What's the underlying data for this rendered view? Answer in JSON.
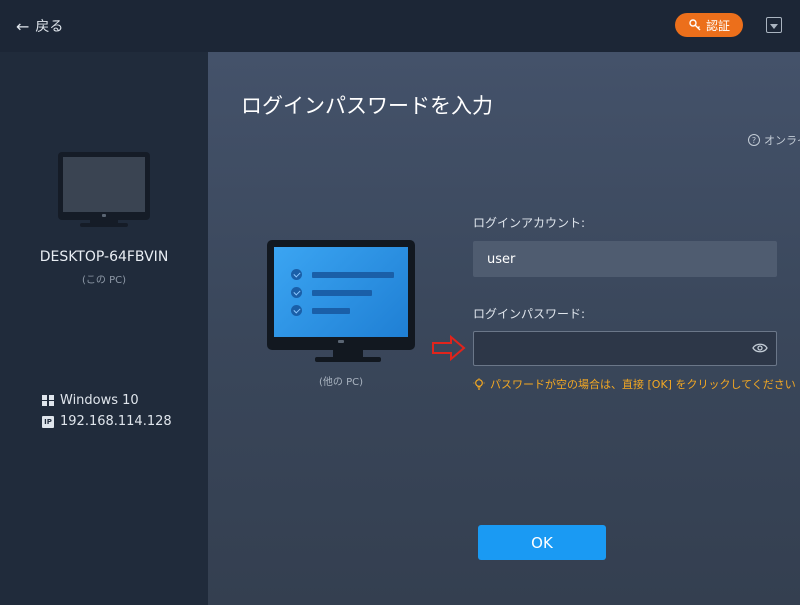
{
  "topbar": {
    "back_label": "戻る",
    "auth_label": "認証",
    "accent_color": "#ec6f1b"
  },
  "sidebar": {
    "pc_name": "DESKTOP-64FBVIN",
    "pc_sub": "(この PC)",
    "os": "Windows 10",
    "ip": "192.168.114.128"
  },
  "main": {
    "title": "ログインパスワードを入力",
    "online_help": "オンライ",
    "other_pc_label": "(他の PC)",
    "account_label": "ログインアカウント:",
    "account_value": "user",
    "password_label": "ログインパスワード:",
    "password_value": "",
    "hint": "パスワードが空の場合は、直接 [OK] をクリックしてください",
    "ok_label": "OK"
  },
  "icons": {
    "back": "arrow-left-icon",
    "auth": "key-icon",
    "dropdown": "dropdown-icon",
    "os": "windows-icon",
    "ip": "ip-icon",
    "help": "help-circle-icon",
    "eye": "eye-icon",
    "hint": "bulb-icon",
    "pointer": "red-arrow-icon"
  }
}
